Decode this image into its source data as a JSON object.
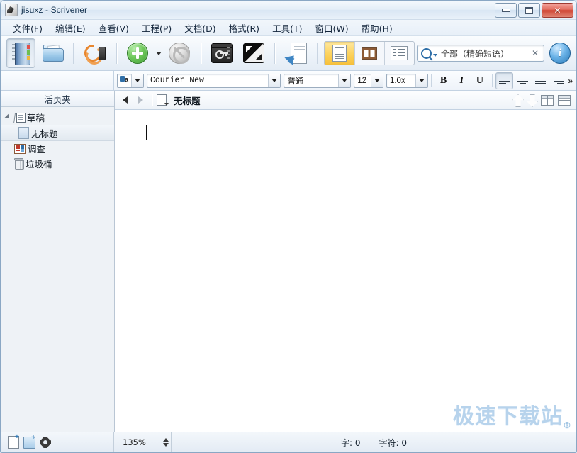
{
  "window": {
    "title": "jisuxz - Scrivener",
    "app_icon": "scrivener-icon",
    "minimize_label": "",
    "maximize_label": "",
    "close_label": "✕"
  },
  "menubar": {
    "items": [
      {
        "label": "文件(F)",
        "name": "menu-file"
      },
      {
        "label": "编辑(E)",
        "name": "menu-edit"
      },
      {
        "label": "查看(V)",
        "name": "menu-view"
      },
      {
        "label": "工程(P)",
        "name": "menu-project"
      },
      {
        "label": "文档(D)",
        "name": "menu-document"
      },
      {
        "label": "格式(R)",
        "name": "menu-format"
      },
      {
        "label": "工具(T)",
        "name": "menu-tools"
      },
      {
        "label": "窗口(W)",
        "name": "menu-window"
      },
      {
        "label": "帮助(H)",
        "name": "menu-help"
      }
    ]
  },
  "toolbar": {
    "buttons": [
      {
        "name": "binder-toggle-button",
        "icon": "notebook-icon",
        "pressed": true
      },
      {
        "name": "collections-button",
        "icon": "folder-icon",
        "pressed": false
      },
      {
        "name": "sync-button",
        "icon": "sync-arrows-icon",
        "pressed": false
      },
      {
        "name": "add-button",
        "icon": "green-plus-icon",
        "pressed": false
      },
      {
        "name": "no-style-button",
        "icon": "ban-icon",
        "pressed": false
      },
      {
        "name": "keywords-button",
        "icon": "key-icon",
        "pressed": false
      },
      {
        "name": "full-screen-button",
        "icon": "fullscreen-icon",
        "pressed": false
      },
      {
        "name": "import-document-button",
        "icon": "document-import-icon",
        "pressed": false
      }
    ],
    "view_group": [
      {
        "name": "view-document-button",
        "icon": "document-view-icon",
        "selected": true
      },
      {
        "name": "view-corkboard-button",
        "icon": "corkboard-icon",
        "selected": false
      },
      {
        "name": "view-outliner-button",
        "icon": "outliner-icon",
        "selected": false
      }
    ],
    "search": {
      "value": "全部（精确短语）",
      "clear_label": "✕",
      "icon": "search-icon"
    },
    "inspector": {
      "name": "inspector-button",
      "label": "i"
    }
  },
  "formatbar": {
    "style_icon": "paragraph-style-icon",
    "font_family": "Courier New",
    "paragraph_style": "普通",
    "font_size": "12",
    "line_spacing": "1.0x",
    "bold_label": "B",
    "italic_label": "I",
    "underline_label": "U",
    "align_left": "align-left",
    "align_center": "align-center",
    "align_justify": "align-justify",
    "align_right": "align-right",
    "overflow_label": "»"
  },
  "binder": {
    "header": "活页夹",
    "items": [
      {
        "label": "草稿",
        "icon": "draft-stack-icon",
        "level": 0,
        "expanded": true,
        "selected": false
      },
      {
        "label": "无标题",
        "icon": "page-icon",
        "level": 1,
        "expanded": false,
        "selected": true
      },
      {
        "label": "调查",
        "icon": "research-icon",
        "level": 0,
        "expanded": false,
        "selected": false
      },
      {
        "label": "垃圾桶",
        "icon": "trash-icon",
        "level": 0,
        "expanded": false,
        "selected": false
      }
    ]
  },
  "editor": {
    "back_label": "◀",
    "forward_label": "▶",
    "doc_icon": "document-dropdown-icon",
    "title": "无标题",
    "content": "",
    "right_buttons": [
      {
        "name": "go-up-button",
        "icon": "arrow-up-icon"
      },
      {
        "name": "go-down-button",
        "icon": "arrow-down-icon"
      },
      {
        "name": "split-vertical-button",
        "icon": "split-vertical-icon"
      },
      {
        "name": "split-horizontal-button",
        "icon": "split-horizontal-icon"
      }
    ],
    "watermark": "极速下载站",
    "watermark_mark": "®"
  },
  "statusbar": {
    "new_document_icon": "new-document-icon",
    "new_folder_icon": "new-folder-icon",
    "settings_icon": "gear-icon",
    "zoom": "135%",
    "word_count_label": "字: 0",
    "char_count_label": "字符: 0"
  },
  "colors": {
    "accent_blue": "#2f6fa8",
    "add_green": "#3d9c32",
    "close_red": "#cf4634",
    "selected_yellow": "#fcd25c",
    "watermark_blue": "#b7d3ec"
  }
}
